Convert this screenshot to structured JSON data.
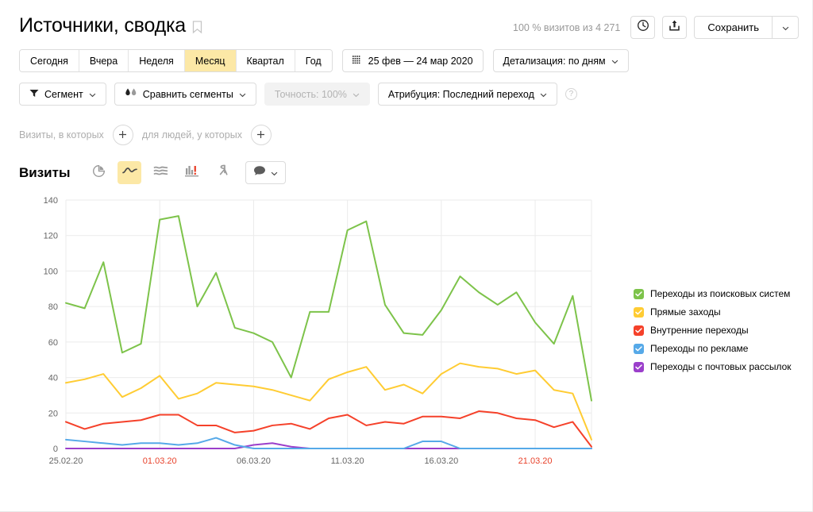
{
  "header": {
    "title": "Источники, сводка",
    "bookmark_icon": "bookmark-icon",
    "visits_note": "100 % визитов из 4 271",
    "history_icon": "clock-icon",
    "export_icon": "share-export-icon",
    "save_label": "Сохранить",
    "save_caret_icon": "chevron-down-icon"
  },
  "period_tabs": {
    "items": [
      {
        "label": "Сегодня",
        "active": false
      },
      {
        "label": "Вчера",
        "active": false
      },
      {
        "label": "Неделя",
        "active": false
      },
      {
        "label": "Месяц",
        "active": true
      },
      {
        "label": "Квартал",
        "active": false
      },
      {
        "label": "Год",
        "active": false
      }
    ],
    "date_range": "25 фев — 24 мар 2020",
    "calendar_icon": "calendar-icon",
    "detail_label": "Детализация: по дням"
  },
  "filters": {
    "segment_label": "Сегмент",
    "segment_icon": "funnel-icon",
    "compare_label": "Сравнить сегменты",
    "compare_icon": "compare-drops-icon",
    "accuracy_label": "Точность: 100%",
    "attribution_label": "Атрибуция: Последний переход",
    "help_icon": "question-icon"
  },
  "visit_filter": {
    "visits_text": "Визиты, в которых",
    "people_text": "для людей, у которых",
    "add_icon": "plus-icon"
  },
  "metric_bar": {
    "metric_label": "Визиты",
    "types": [
      {
        "name": "pie-chart-icon",
        "active": false
      },
      {
        "name": "line-chart-icon",
        "active": true
      },
      {
        "name": "area-chart-icon",
        "active": false
      },
      {
        "name": "bar-chart-icon",
        "active": false
      },
      {
        "name": "map-chart-icon",
        "active": false
      }
    ],
    "comment_icon": "comment-icon",
    "comment_caret_icon": "chevron-down-icon"
  },
  "colors": {
    "green": "#7DC34A",
    "yellow": "#FFCC33",
    "red": "#F5412A",
    "blue": "#56A9E8",
    "purple": "#9B3FCB",
    "accent_yellow": "#FCE8A6",
    "grid": "#EBEBEB",
    "axis_text": "#666666",
    "weekend_text": "#E8422B"
  },
  "chart_data": {
    "type": "line",
    "title": "Визиты",
    "xlabel": "",
    "ylabel": "",
    "ylim": [
      0,
      140
    ],
    "yticks": [
      0,
      20,
      40,
      60,
      80,
      100,
      120,
      140
    ],
    "grid": true,
    "legend_position": "right",
    "x": [
      "25.02.20",
      "26.02.20",
      "27.02.20",
      "28.02.20",
      "29.02.20",
      "01.03.20",
      "02.03.20",
      "03.03.20",
      "04.03.20",
      "05.03.20",
      "06.03.20",
      "07.03.20",
      "08.03.20",
      "09.03.20",
      "10.03.20",
      "11.03.20",
      "12.03.20",
      "13.03.20",
      "14.03.20",
      "15.03.20",
      "16.03.20",
      "17.03.20",
      "18.03.20",
      "19.03.20",
      "20.03.20",
      "21.03.20",
      "22.03.20",
      "23.03.20",
      "24.03.20"
    ],
    "xtick_labels": [
      {
        "label": "25.02.20",
        "index": 0,
        "weekend": false
      },
      {
        "label": "01.03.20",
        "index": 5,
        "weekend": true
      },
      {
        "label": "06.03.20",
        "index": 10,
        "weekend": false
      },
      {
        "label": "11.03.20",
        "index": 15,
        "weekend": false
      },
      {
        "label": "16.03.20",
        "index": 20,
        "weekend": false
      },
      {
        "label": "21.03.20",
        "index": 25,
        "weekend": true
      }
    ],
    "series": [
      {
        "name": "Переходы из поисковых систем",
        "color": "#7DC34A",
        "values": [
          82,
          79,
          105,
          54,
          59,
          129,
          131,
          80,
          99,
          68,
          65,
          60,
          40,
          77,
          77,
          123,
          128,
          81,
          65,
          64,
          78,
          97,
          88,
          81,
          88,
          71,
          59,
          86,
          27
        ]
      },
      {
        "name": "Прямые заходы",
        "color": "#FFCC33",
        "values": [
          37,
          39,
          42,
          29,
          34,
          41,
          28,
          31,
          37,
          36,
          35,
          33,
          30,
          27,
          39,
          43,
          46,
          33,
          36,
          31,
          42,
          48,
          46,
          45,
          42,
          44,
          33,
          31,
          5
        ]
      },
      {
        "name": "Внутренние переходы",
        "color": "#F5412A",
        "values": [
          15,
          11,
          14,
          15,
          16,
          19,
          19,
          13,
          13,
          9,
          10,
          13,
          14,
          11,
          17,
          19,
          13,
          15,
          14,
          18,
          18,
          17,
          21,
          20,
          17,
          16,
          12,
          15,
          1
        ]
      },
      {
        "name": "Переходы по рекламе",
        "color": "#56A9E8",
        "values": [
          5,
          4,
          3,
          2,
          3,
          3,
          2,
          3,
          6,
          2,
          0,
          0,
          0,
          0,
          0,
          0,
          0,
          0,
          0,
          4,
          4,
          0,
          0,
          0,
          0,
          0,
          0,
          0,
          0
        ]
      },
      {
        "name": "Переходы с почтовых рассылок",
        "color": "#9B3FCB",
        "values": [
          0,
          0,
          0,
          0,
          0,
          0,
          0,
          0,
          0,
          0,
          2,
          3,
          1,
          0,
          0,
          0,
          0,
          0,
          0,
          0,
          0,
          0,
          0,
          0,
          0,
          0,
          0,
          0,
          0
        ]
      }
    ]
  }
}
